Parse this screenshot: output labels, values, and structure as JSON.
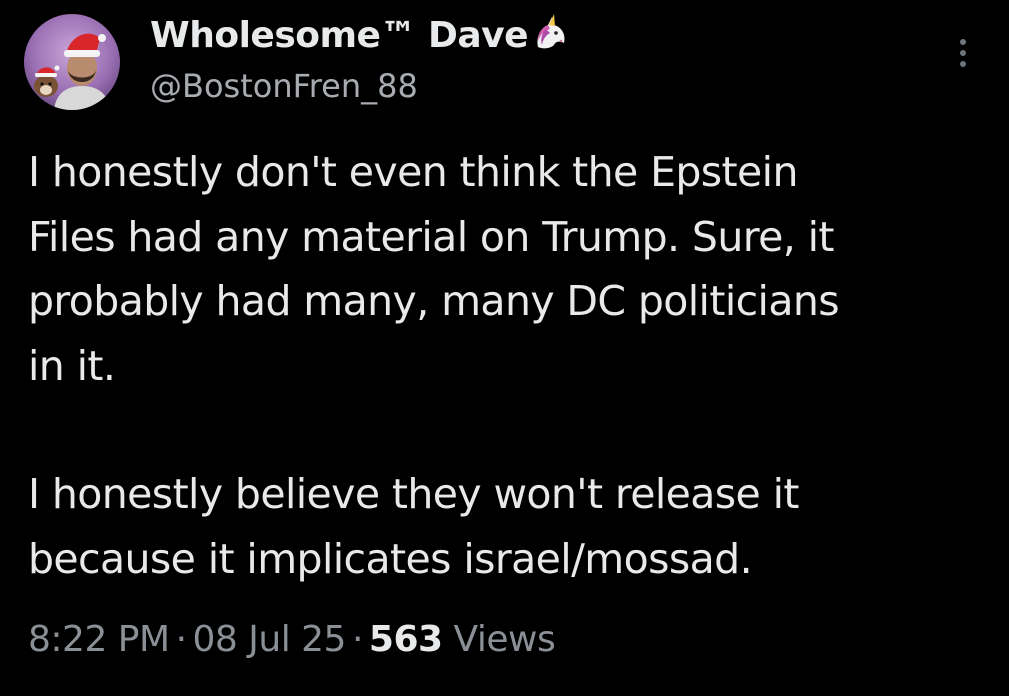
{
  "author": {
    "display_name": "Wholesome™ Dave",
    "emoji_icon": "unicorn-icon",
    "handle": "@BostonFren_88"
  },
  "post": {
    "paragraphs": [
      "I honestly don't even think the Epstein\nFiles had any material on Trump.  Sure, it\nprobably had many, many DC politicians\nin it.",
      "I honestly believe they won't release it\nbecause it implicates israel/mossad."
    ]
  },
  "meta": {
    "time": "8:22 PM",
    "separator": "·",
    "date": "08 Jul 25",
    "views_count": "563",
    "views_label": "Views"
  },
  "icons": {
    "more": "more-vertical-icon",
    "avatar": "avatar"
  },
  "colors": {
    "background": "#000000",
    "primary_text": "#e7e9ea",
    "secondary_text": "#8b9096"
  }
}
